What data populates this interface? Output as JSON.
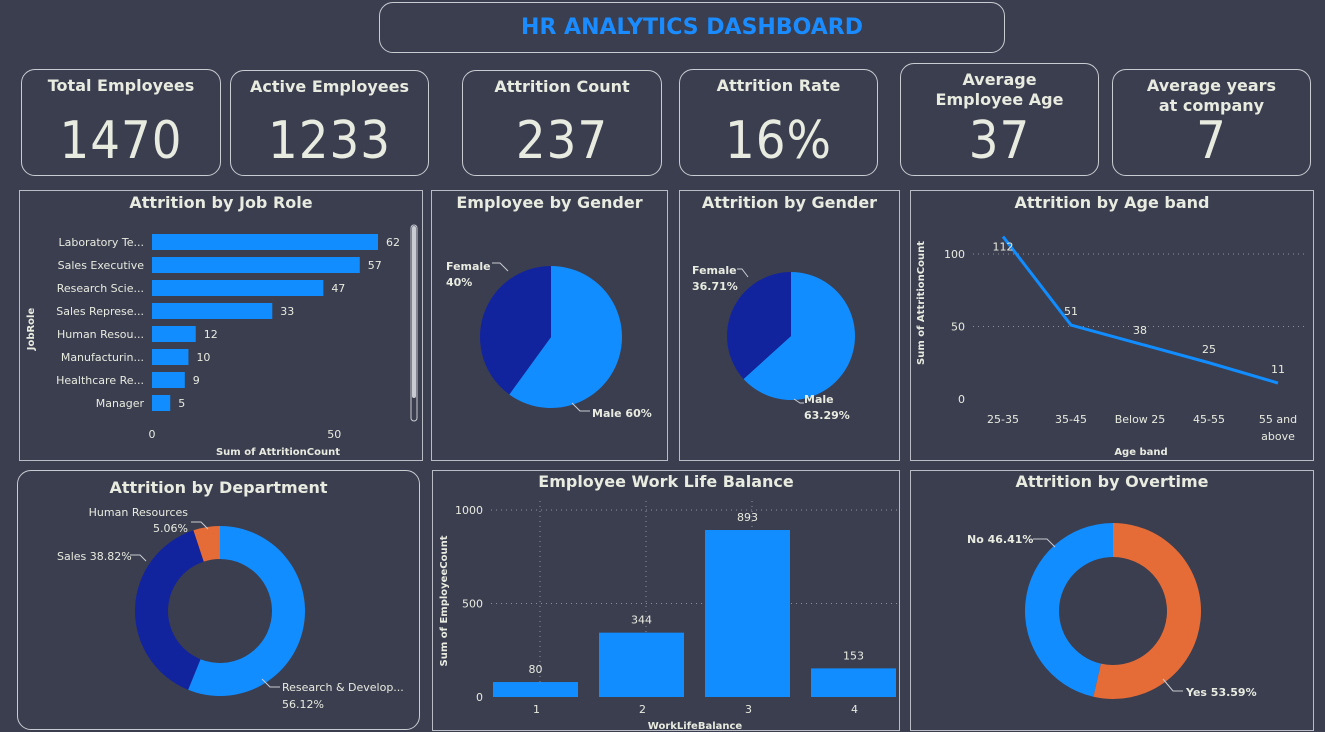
{
  "header": {
    "title": "HR ANALYTICS DASHBOARD"
  },
  "kpis": [
    {
      "label": "Total Employees",
      "value": "1470"
    },
    {
      "label": "Active Employees",
      "value": "1233"
    },
    {
      "label": "Attrition Count",
      "value": "237"
    },
    {
      "label": "Attrition Rate",
      "value": "16%"
    },
    {
      "label": "Average Employee Age",
      "value": "37"
    },
    {
      "label": "Average years at company",
      "value": "7"
    }
  ],
  "colors": {
    "primary": "#118dff",
    "dark_blue": "#12239e",
    "orange": "#e66c37",
    "background": "#3b3e4f",
    "text": "#e8ebe0"
  },
  "chart_data": [
    {
      "type": "bar",
      "orientation": "horizontal",
      "title": "Attrition by Job Role",
      "xlabel": "Sum of AttritionCount",
      "ylabel": "JobRole",
      "categories": [
        "Laboratory Te...",
        "Sales Executive",
        "Research Scie...",
        "Sales Represe...",
        "Human Resou...",
        "Manufacturin...",
        "Healthcare Re...",
        "Manager"
      ],
      "values": [
        62,
        57,
        47,
        33,
        12,
        10,
        9,
        5
      ],
      "xticks": [
        0,
        50
      ],
      "xlim": [
        0,
        62
      ]
    },
    {
      "type": "pie",
      "title": "Employee by Gender",
      "labels": [
        "Female",
        "Male"
      ],
      "values": [
        40,
        60
      ],
      "display_labels": [
        "Female\n40%",
        "Male 60%"
      ]
    },
    {
      "type": "pie",
      "title": "Attrition by Gender",
      "labels": [
        "Female",
        "Male"
      ],
      "values": [
        36.71,
        63.29
      ],
      "display_labels": [
        "Female\n36.71%",
        "Male\n63.29%"
      ]
    },
    {
      "type": "line",
      "title": "Attrition by Age band",
      "xlabel": "Age band",
      "ylabel": "Sum of AttritionCount",
      "categories": [
        "25-35",
        "35-45",
        "Below 25",
        "45-55",
        "55 and\nabove"
      ],
      "values": [
        112,
        51,
        38,
        25,
        11
      ],
      "yticks": [
        0,
        50,
        100
      ],
      "ylim": [
        0,
        120
      ],
      "grid": true
    },
    {
      "type": "pie",
      "subtype": "donut",
      "title": "Attrition by Department",
      "labels": [
        "Human Resources",
        "Sales",
        "Research & Develop..."
      ],
      "values": [
        5.06,
        38.82,
        56.12
      ],
      "display_labels": [
        "Human Resources\n5.06%",
        "Sales 38.82%",
        "Research & Develop...\n56.12%"
      ]
    },
    {
      "type": "bar",
      "title": "Employee Work Life Balance",
      "xlabel": "WorkLifeBalance",
      "ylabel": "Sum of EmployeeCount",
      "categories": [
        "1",
        "2",
        "3",
        "4"
      ],
      "values": [
        80,
        344,
        893,
        153
      ],
      "yticks": [
        0,
        500,
        1000
      ],
      "ylim": [
        0,
        1000
      ],
      "grid": true
    },
    {
      "type": "pie",
      "subtype": "donut",
      "title": "Attrition by Overtime",
      "labels": [
        "No",
        "Yes"
      ],
      "values": [
        46.41,
        53.59
      ],
      "display_labels": [
        "No 46.41%",
        "Yes 53.59%"
      ]
    }
  ]
}
